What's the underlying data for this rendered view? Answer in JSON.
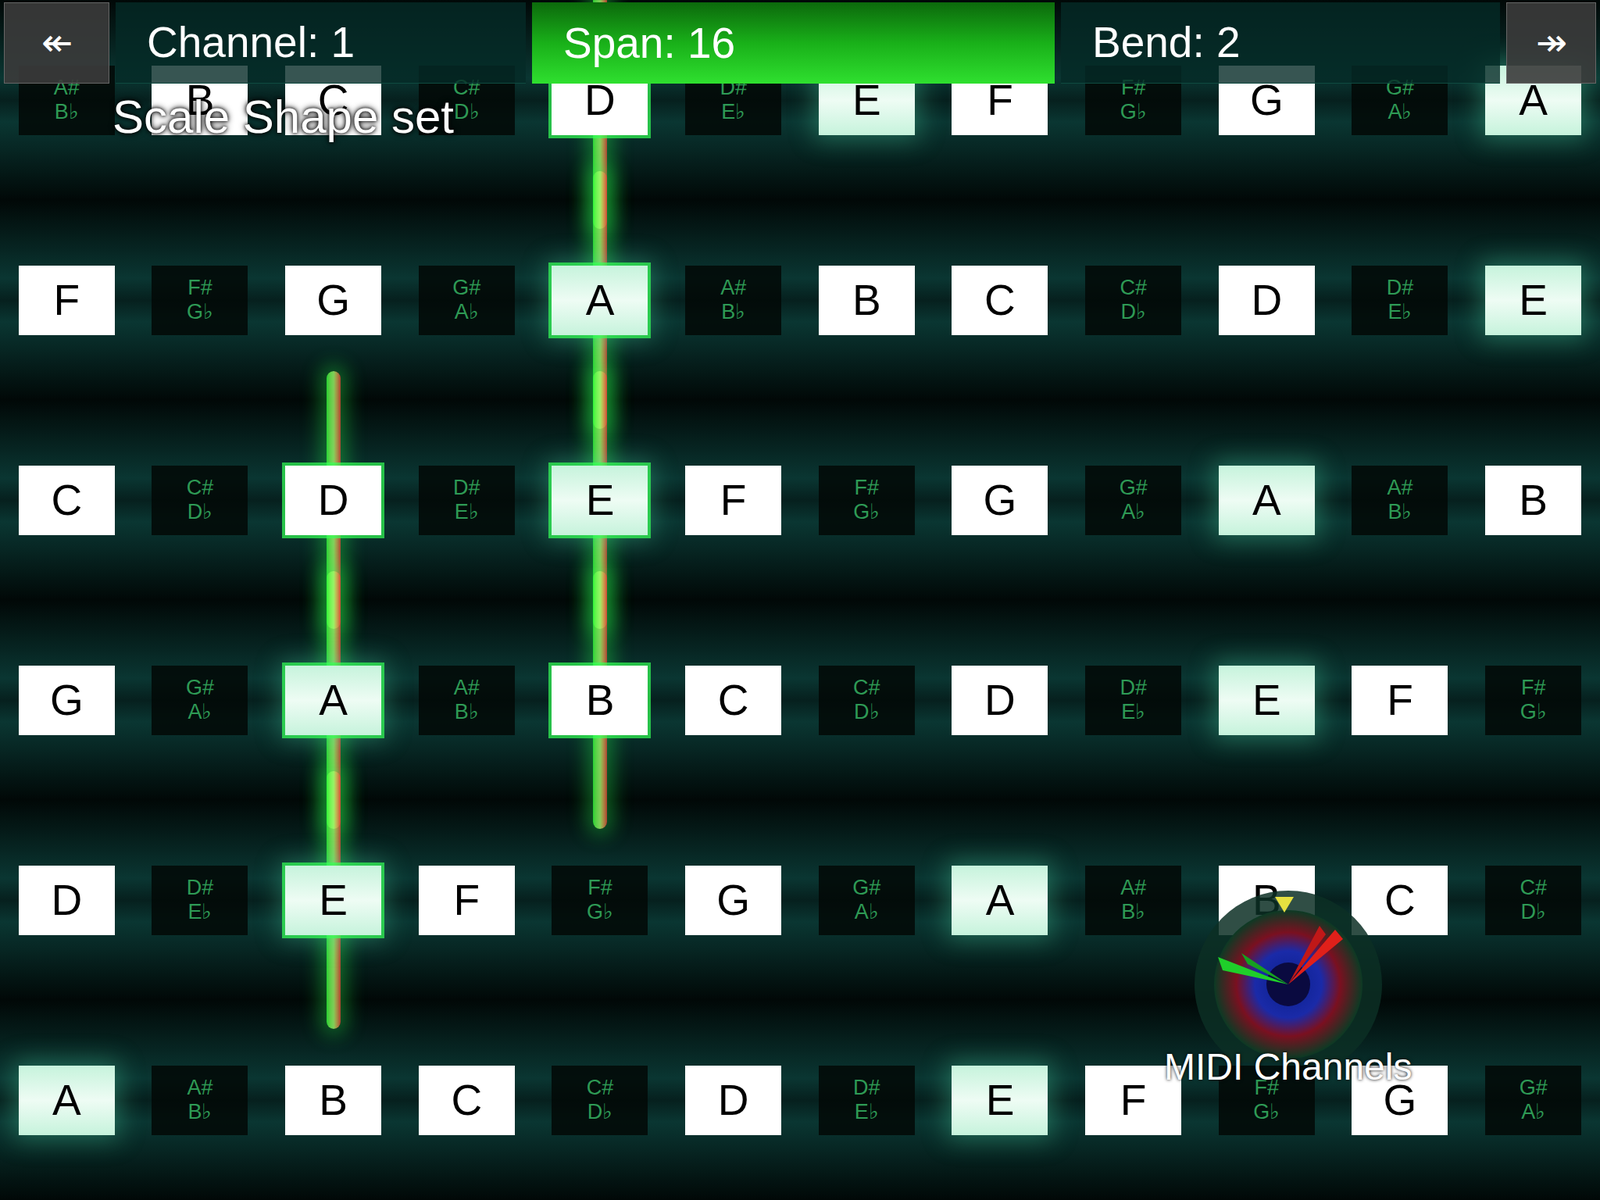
{
  "toolbar": {
    "back": "↞",
    "forward": "↠",
    "fields": [
      {
        "label": "Channel: 1",
        "selected": false
      },
      {
        "label": "Span: 16",
        "selected": true
      },
      {
        "label": "Bend: 2",
        "selected": false
      }
    ]
  },
  "notice": "Scale Shape set",
  "keyboard": {
    "rows": [
      [
        {
          "kind": "sharp",
          "label": "A#",
          "alt": "B♭",
          "in_scale": false,
          "playing": false
        },
        {
          "kind": "natural",
          "label": "B",
          "in_scale": false,
          "playing": false
        },
        {
          "kind": "natural",
          "label": "C",
          "in_scale": false,
          "playing": false
        },
        {
          "kind": "sharp",
          "label": "C#",
          "alt": "D♭",
          "in_scale": false,
          "playing": false
        },
        {
          "kind": "natural",
          "label": "D",
          "in_scale": false,
          "playing": true
        },
        {
          "kind": "sharp",
          "label": "D#",
          "alt": "E♭",
          "in_scale": false,
          "playing": false
        },
        {
          "kind": "natural",
          "label": "E",
          "in_scale": true,
          "playing": false
        },
        {
          "kind": "natural",
          "label": "F",
          "in_scale": false,
          "playing": false
        },
        {
          "kind": "sharp",
          "label": "F#",
          "alt": "G♭",
          "in_scale": false,
          "playing": false
        },
        {
          "kind": "natural",
          "label": "G",
          "in_scale": false,
          "playing": false
        },
        {
          "kind": "sharp",
          "label": "G#",
          "alt": "A♭",
          "in_scale": false,
          "playing": false
        },
        {
          "kind": "natural",
          "label": "A",
          "in_scale": true,
          "playing": false
        }
      ],
      [
        {
          "kind": "natural",
          "label": "F",
          "in_scale": false,
          "playing": false
        },
        {
          "kind": "sharp",
          "label": "F#",
          "alt": "G♭",
          "in_scale": false,
          "playing": false
        },
        {
          "kind": "natural",
          "label": "G",
          "in_scale": false,
          "playing": false
        },
        {
          "kind": "sharp",
          "label": "G#",
          "alt": "A♭",
          "in_scale": false,
          "playing": false
        },
        {
          "kind": "natural",
          "label": "A",
          "in_scale": true,
          "playing": true
        },
        {
          "kind": "sharp",
          "label": "A#",
          "alt": "B♭",
          "in_scale": false,
          "playing": false
        },
        {
          "kind": "natural",
          "label": "B",
          "in_scale": false,
          "playing": false
        },
        {
          "kind": "natural",
          "label": "C",
          "in_scale": false,
          "playing": false
        },
        {
          "kind": "sharp",
          "label": "C#",
          "alt": "D♭",
          "in_scale": false,
          "playing": false
        },
        {
          "kind": "natural",
          "label": "D",
          "in_scale": false,
          "playing": false
        },
        {
          "kind": "sharp",
          "label": "D#",
          "alt": "E♭",
          "in_scale": false,
          "playing": false
        },
        {
          "kind": "natural",
          "label": "E",
          "in_scale": true,
          "playing": false
        }
      ],
      [
        {
          "kind": "natural",
          "label": "C",
          "in_scale": false,
          "playing": false
        },
        {
          "kind": "sharp",
          "label": "C#",
          "alt": "D♭",
          "in_scale": false,
          "playing": false
        },
        {
          "kind": "natural",
          "label": "D",
          "in_scale": false,
          "playing": true
        },
        {
          "kind": "sharp",
          "label": "D#",
          "alt": "E♭",
          "in_scale": false,
          "playing": false
        },
        {
          "kind": "natural",
          "label": "E",
          "in_scale": true,
          "playing": true
        },
        {
          "kind": "natural",
          "label": "F",
          "in_scale": false,
          "playing": false
        },
        {
          "kind": "sharp",
          "label": "F#",
          "alt": "G♭",
          "in_scale": false,
          "playing": false
        },
        {
          "kind": "natural",
          "label": "G",
          "in_scale": false,
          "playing": false
        },
        {
          "kind": "sharp",
          "label": "G#",
          "alt": "A♭",
          "in_scale": false,
          "playing": false
        },
        {
          "kind": "natural",
          "label": "A",
          "in_scale": true,
          "playing": false
        },
        {
          "kind": "sharp",
          "label": "A#",
          "alt": "B♭",
          "in_scale": false,
          "playing": false
        },
        {
          "kind": "natural",
          "label": "B",
          "in_scale": false,
          "playing": false
        }
      ],
      [
        {
          "kind": "natural",
          "label": "G",
          "in_scale": false,
          "playing": false
        },
        {
          "kind": "sharp",
          "label": "G#",
          "alt": "A♭",
          "in_scale": false,
          "playing": false
        },
        {
          "kind": "natural",
          "label": "A",
          "in_scale": true,
          "playing": true
        },
        {
          "kind": "sharp",
          "label": "A#",
          "alt": "B♭",
          "in_scale": false,
          "playing": false
        },
        {
          "kind": "natural",
          "label": "B",
          "in_scale": false,
          "playing": true
        },
        {
          "kind": "natural",
          "label": "C",
          "in_scale": false,
          "playing": false
        },
        {
          "kind": "sharp",
          "label": "C#",
          "alt": "D♭",
          "in_scale": false,
          "playing": false
        },
        {
          "kind": "natural",
          "label": "D",
          "in_scale": false,
          "playing": false
        },
        {
          "kind": "sharp",
          "label": "D#",
          "alt": "E♭",
          "in_scale": false,
          "playing": false
        },
        {
          "kind": "natural",
          "label": "E",
          "in_scale": true,
          "playing": false
        },
        {
          "kind": "natural",
          "label": "F",
          "in_scale": false,
          "playing": false
        },
        {
          "kind": "sharp",
          "label": "F#",
          "alt": "G♭",
          "in_scale": false,
          "playing": false
        }
      ],
      [
        {
          "kind": "natural",
          "label": "D",
          "in_scale": false,
          "playing": false
        },
        {
          "kind": "sharp",
          "label": "D#",
          "alt": "E♭",
          "in_scale": false,
          "playing": false
        },
        {
          "kind": "natural",
          "label": "E",
          "in_scale": true,
          "playing": true
        },
        {
          "kind": "natural",
          "label": "F",
          "in_scale": false,
          "playing": false
        },
        {
          "kind": "sharp",
          "label": "F#",
          "alt": "G♭",
          "in_scale": false,
          "playing": false
        },
        {
          "kind": "natural",
          "label": "G",
          "in_scale": false,
          "playing": false
        },
        {
          "kind": "sharp",
          "label": "G#",
          "alt": "A♭",
          "in_scale": false,
          "playing": false
        },
        {
          "kind": "natural",
          "label": "A",
          "in_scale": true,
          "playing": false
        },
        {
          "kind": "sharp",
          "label": "A#",
          "alt": "B♭",
          "in_scale": false,
          "playing": false
        },
        {
          "kind": "natural",
          "label": "B",
          "in_scale": false,
          "playing": false
        },
        {
          "kind": "natural",
          "label": "C",
          "in_scale": false,
          "playing": false
        },
        {
          "kind": "sharp",
          "label": "C#",
          "alt": "D♭",
          "in_scale": false,
          "playing": false
        }
      ],
      [
        {
          "kind": "natural",
          "label": "A",
          "in_scale": true,
          "playing": false
        },
        {
          "kind": "sharp",
          "label": "A#",
          "alt": "B♭",
          "in_scale": false,
          "playing": false
        },
        {
          "kind": "natural",
          "label": "B",
          "in_scale": false,
          "playing": false
        },
        {
          "kind": "natural",
          "label": "C",
          "in_scale": false,
          "playing": false
        },
        {
          "kind": "sharp",
          "label": "C#",
          "alt": "D♭",
          "in_scale": false,
          "playing": false
        },
        {
          "kind": "natural",
          "label": "D",
          "in_scale": false,
          "playing": false
        },
        {
          "kind": "sharp",
          "label": "D#",
          "alt": "E♭",
          "in_scale": false,
          "playing": false
        },
        {
          "kind": "natural",
          "label": "E",
          "in_scale": true,
          "playing": false
        },
        {
          "kind": "natural",
          "label": "F",
          "in_scale": false,
          "playing": false
        },
        {
          "kind": "sharp",
          "label": "F#",
          "alt": "G♭",
          "in_scale": false,
          "playing": false
        },
        {
          "kind": "natural",
          "label": "G",
          "in_scale": false,
          "playing": false
        },
        {
          "kind": "sharp",
          "label": "G#",
          "alt": "A♭",
          "in_scale": false,
          "playing": false
        }
      ]
    ]
  },
  "midi_widget": {
    "label": "MIDI Channels"
  }
}
